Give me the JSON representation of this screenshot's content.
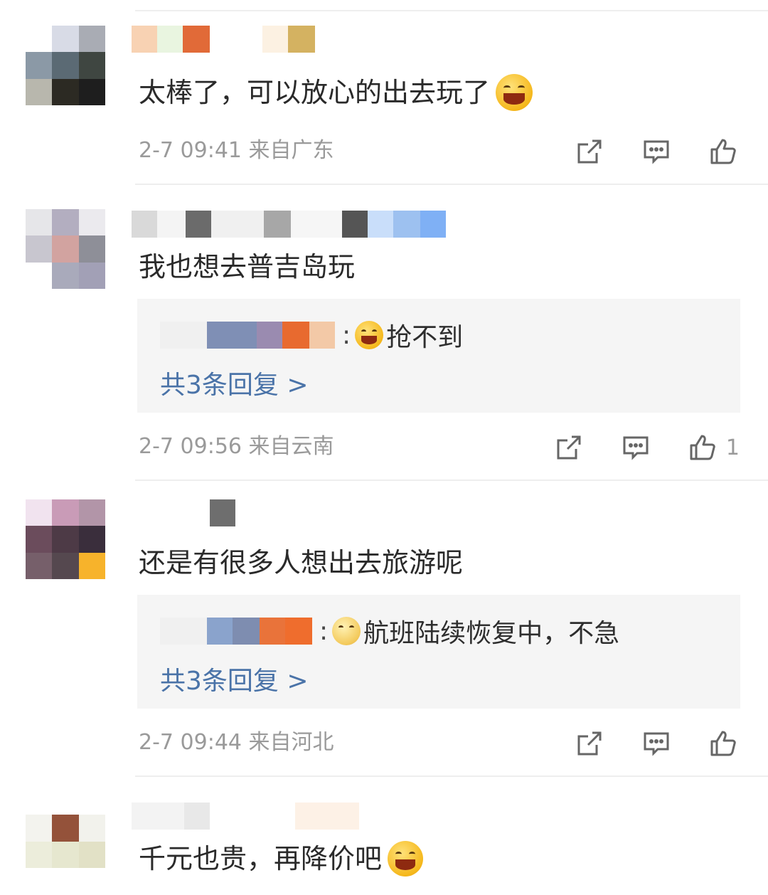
{
  "comments": [
    {
      "text": "太棒了，可以放心的出去玩了",
      "emoji": "laughing-crying-emoji",
      "time": "2-7 09:41",
      "location": "来自广东",
      "like_count": ""
    },
    {
      "text": "我也想去普吉岛玩",
      "reply": {
        "text": "抢不到",
        "emoji": "laughing-emoji",
        "more": "共3条回复 >"
      },
      "time": "2-7 09:56",
      "location": "来自云南",
      "like_count": "1"
    },
    {
      "text": "还是有很多人想出去旅游呢",
      "reply": {
        "text": "航班陆续恢复中，不急",
        "emoji": "sleepy-emoji",
        "more": "共3条回复 >"
      },
      "time": "2-7 09:44",
      "location": "来自河北",
      "like_count": ""
    },
    {
      "text": "千元也贵，再降价吧",
      "emoji": "laughing-emoji"
    }
  ],
  "reply_separator": ":",
  "icons": [
    "share-icon",
    "comment-icon",
    "like-icon"
  ],
  "colors": {
    "link": "#4a73a8",
    "meta": "#9a9a9a",
    "reply_bg": "#f5f5f5"
  }
}
